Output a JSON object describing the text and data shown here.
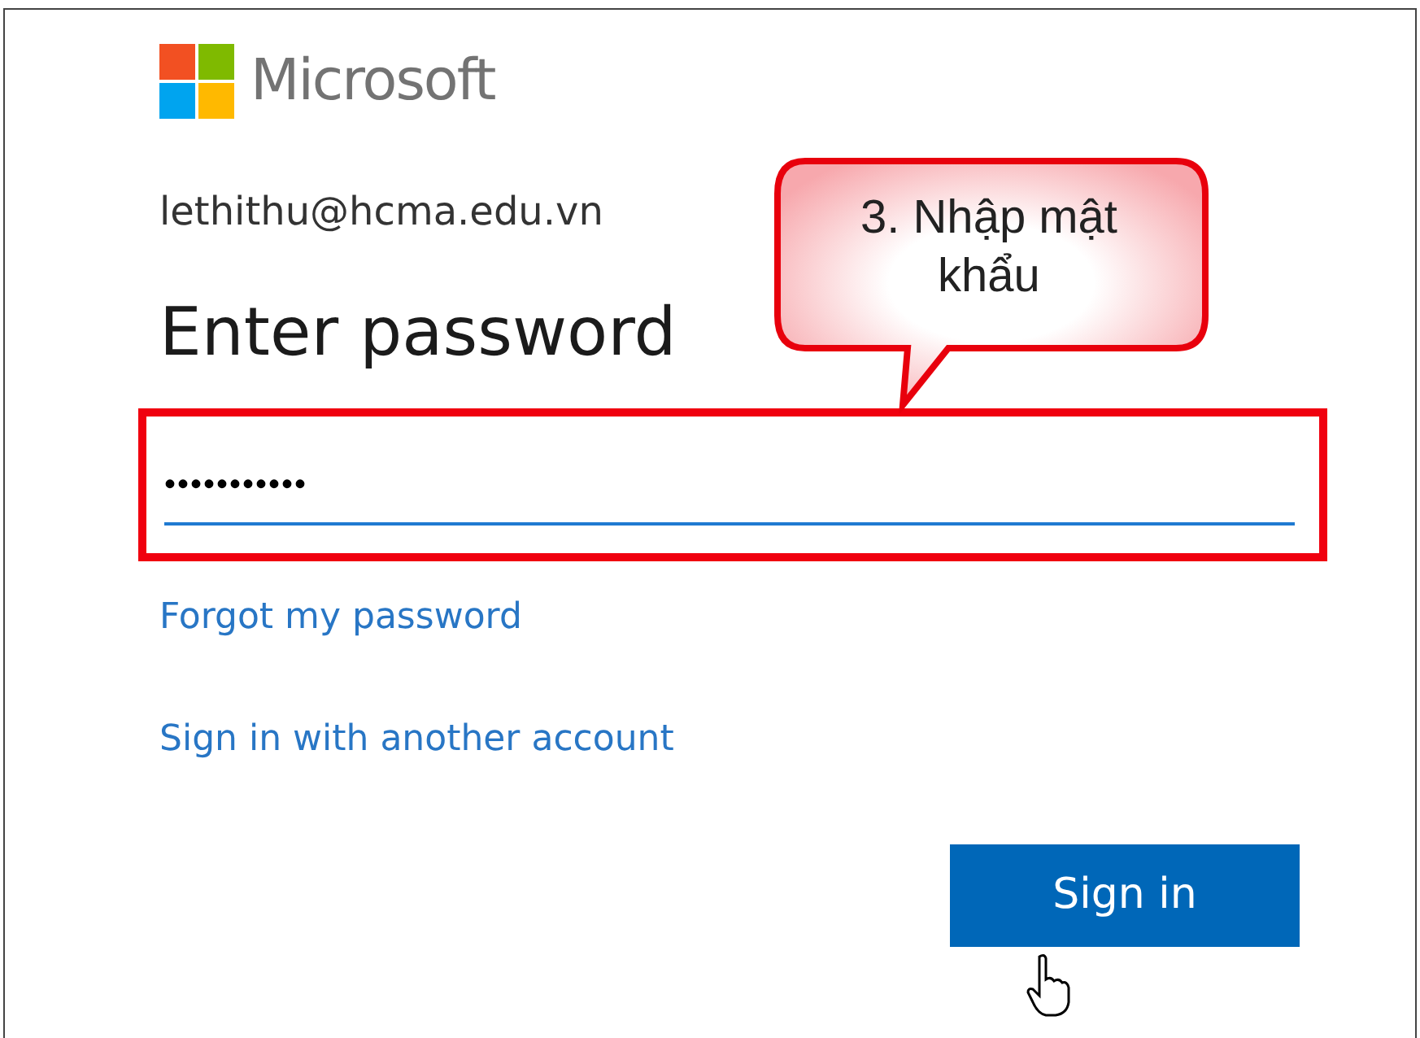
{
  "logo": {
    "text": "Microsoft"
  },
  "account": "lethithu@hcma.edu.vn",
  "heading": "Enter password",
  "password_field": {
    "value": "•••••••••••",
    "highlighted": true
  },
  "links": [
    "Forgot my password",
    "Sign in with another account"
  ],
  "button": "Sign in",
  "callout": {
    "text": "3. Nhập mật khẩu"
  }
}
